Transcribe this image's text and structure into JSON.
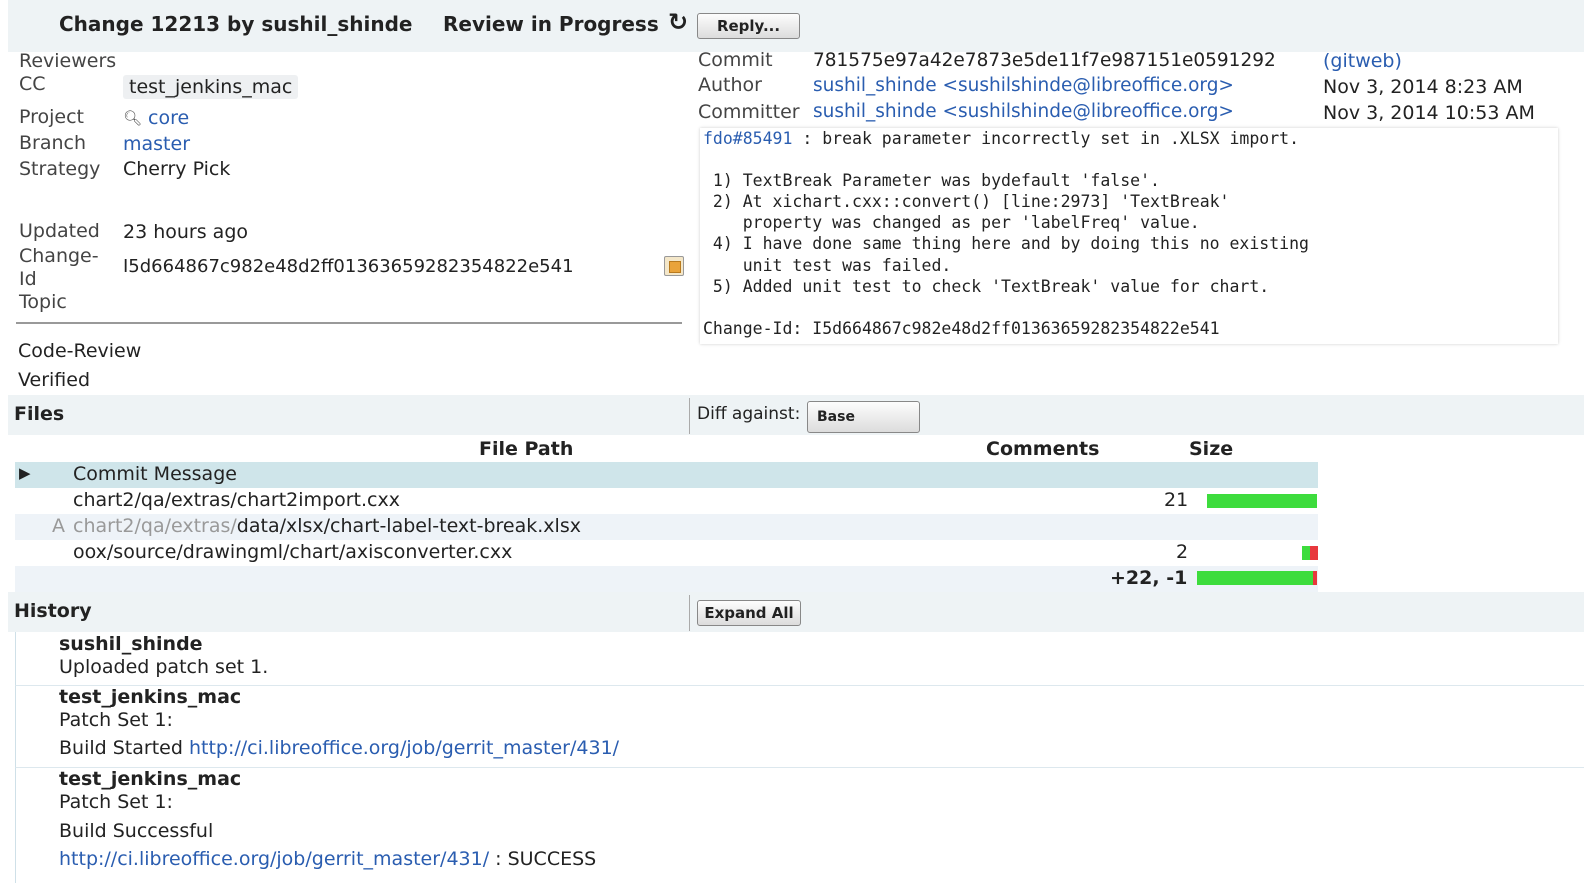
{
  "header": {
    "title": "Change 12213 by sushil_shinde",
    "status": "Review in Progress",
    "reply_label": "Reply..."
  },
  "info": {
    "reviewers_label": "Reviewers",
    "cc_label": "CC",
    "cc_value": "test_jenkins_mac",
    "project_label": "Project",
    "project_value": "core",
    "branch_label": "Branch",
    "branch_value": "master",
    "strategy_label": "Strategy",
    "strategy_value": "Cherry Pick",
    "updated_label": "Updated",
    "updated_value": "23 hours ago",
    "changeid_label_1": "Change-",
    "changeid_label_2": "Id",
    "changeid_value": "I5d664867c982e48d2ff01363659282354822e541",
    "topic_label": "Topic",
    "code_review_label": "Code-Review",
    "verified_label": "Verified"
  },
  "commit": {
    "commit_label": "Commit",
    "commit_value": "781575e97a42e7873e5de11f7e987151e0591292",
    "gitweb": "(gitweb)",
    "author_label": "Author",
    "author_value": "sushil_shinde <sushilshinde@libreoffice.org>",
    "author_date": "Nov 3, 2014 8:23 AM",
    "committer_label": "Committer",
    "committer_value": "sushil_shinde <sushilshinde@libreoffice.org>",
    "committer_date": "Nov 3, 2014 10:53 AM",
    "message_link": "fdo#85491",
    "message_first": " : break parameter incorrectly set in .XLSX import.",
    "message_body": "\n\n 1) TextBreak Parameter was bydefault 'false'.\n 2) At xichart.cxx::convert() [line:2973] 'TextBreak'\n    property was changed as per 'labelFreq' value.\n 4) I have done same thing here and by doing this no existing\n    unit test was failed.\n 5) Added unit test to check 'TextBreak' value for chart.\n\nChange-Id: I5d664867c982e48d2ff01363659282354822e541"
  },
  "files": {
    "section_title": "Files",
    "diff_against_label": "Diff against:",
    "diff_against_value": "Base",
    "col_path": "File Path",
    "col_comments": "Comments",
    "col_size": "Size",
    "rows": [
      {
        "marker": "",
        "prefix": "",
        "path": "Commit Message",
        "size": "",
        "added": 0,
        "removed": 0
      },
      {
        "marker": "",
        "prefix": "",
        "path": "chart2/qa/extras/chart2import.cxx",
        "size": "21",
        "added": 21,
        "removed": 0
      },
      {
        "marker": "A",
        "prefix": "chart2/qa/extras/",
        "path": "data/xlsx/chart-label-text-break.xlsx",
        "size": "",
        "added": 0,
        "removed": 0
      },
      {
        "marker": "",
        "prefix": "",
        "path": "oox/source/drawingml/chart/axisconverter.cxx",
        "size": "2",
        "added": 1,
        "removed": 1
      }
    ],
    "total": "+22, -1",
    "total_added": 22,
    "total_removed": 1
  },
  "history": {
    "section_title": "History",
    "expand_label": "Expand All",
    "entries": [
      {
        "author": "sushil_shinde",
        "line1": "Uploaded patch set 1."
      },
      {
        "author": "test_jenkins_mac",
        "line1": "Patch Set 1:",
        "line2_text": "Build Started ",
        "line2_link": "http://ci.libreoffice.org/job/gerrit_master/431/"
      },
      {
        "author": "test_jenkins_mac",
        "line1": "Patch Set 1:",
        "line2_text": "Build Successful",
        "line3_link": "http://ci.libreoffice.org/job/gerrit_master/431/",
        "line3_text": " : SUCCESS"
      }
    ]
  },
  "colors": {
    "added": "#3ddc3d",
    "removed": "#e8383d",
    "link": "#2a5db0",
    "header_bg": "#eef3f5",
    "selected_row": "#cfe5ea"
  }
}
